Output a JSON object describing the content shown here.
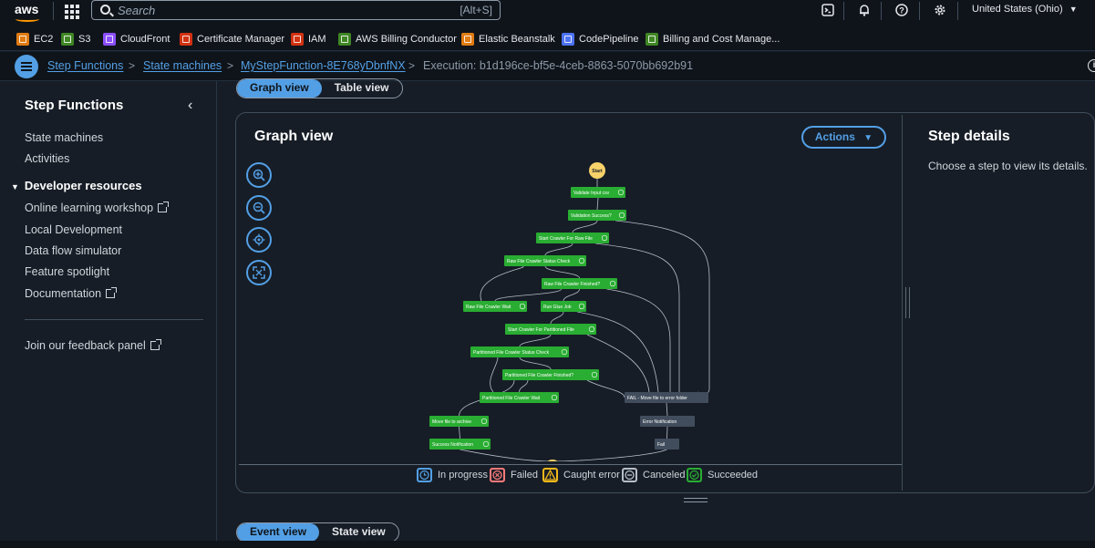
{
  "topbar": {
    "logo_text": "aws",
    "search_placeholder": "Search",
    "search_shortcut": "[Alt+S]",
    "region": "United States (Ohio)",
    "icons": [
      "cloudshell-icon",
      "bell-icon",
      "help-icon",
      "gear-icon"
    ]
  },
  "favorites": [
    {
      "label": "EC2",
      "color": "#e07b12"
    },
    {
      "label": "S3",
      "color": "#3f8624"
    },
    {
      "label": "CloudFront",
      "color": "#8c4fff"
    },
    {
      "label": "Certificate Manager",
      "color": "#d13212"
    },
    {
      "label": "IAM",
      "color": "#d13212"
    },
    {
      "label": "AWS Billing Conductor",
      "color": "#3f8624"
    },
    {
      "label": "Elastic Beanstalk",
      "color": "#e07b12"
    },
    {
      "label": "CodePipeline",
      "color": "#4d72f3"
    },
    {
      "label": "Billing and Cost Manage...",
      "color": "#3f8624"
    }
  ],
  "breadcrumb": {
    "items": [
      "Step Functions",
      "State machines",
      "MyStepFunction-8E768yDbnfNX"
    ],
    "current": "Execution: b1d196ce-bf5e-4ceb-8863-5070bb692b91"
  },
  "sidebar": {
    "title": "Step Functions",
    "items": [
      "State machines",
      "Activities"
    ],
    "section_title": "Developer resources",
    "section_items": [
      "Online learning workshop",
      "Local Development",
      "Data flow simulator",
      "Feature spotlight",
      "Documentation"
    ],
    "feedback": "Join our feedback panel"
  },
  "view_tabs": {
    "graph": "Graph view",
    "table": "Table view"
  },
  "graph_panel": {
    "title": "Graph view",
    "actions_label": "Actions",
    "zoom_controls": [
      "zoom-in-icon",
      "zoom-out-icon",
      "center-icon",
      "fit-icon"
    ]
  },
  "graph": {
    "start_label": "Start",
    "nodes": [
      {
        "label": "Validate Input csv",
        "status": "succeeded"
      },
      {
        "label": "Validation Success?",
        "status": "succeeded"
      },
      {
        "label": "Start Crawler For Raw File",
        "status": "succeeded"
      },
      {
        "label": "Raw File Crawler Status Check",
        "status": "succeeded"
      },
      {
        "label": "Raw File Crawler Finished?",
        "status": "succeeded"
      },
      {
        "label": "Raw File Crawler Wait",
        "status": "succeeded"
      },
      {
        "label": "Run Glue Job",
        "status": "succeeded"
      },
      {
        "label": "Start Crawler For Partitioned File",
        "status": "succeeded"
      },
      {
        "label": "Partitioned File Crawler Status Check",
        "status": "succeeded"
      },
      {
        "label": "Partitioned File Crawler Finished?",
        "status": "succeeded"
      },
      {
        "label": "Partitioned File Crawler Wait",
        "status": "succeeded"
      },
      {
        "label": "FAIL - Move file to error folder",
        "status": "not-run"
      },
      {
        "label": "Move file to archive",
        "status": "succeeded"
      },
      {
        "label": "Error Notification",
        "status": "not-run"
      },
      {
        "label": "Success Notification",
        "status": "succeeded"
      },
      {
        "label": "Fail",
        "status": "not-run"
      }
    ]
  },
  "details": {
    "title": "Step details",
    "text": "Choose a step to view its details."
  },
  "legend": [
    {
      "label": "In progress",
      "color": "#539fe5"
    },
    {
      "label": "Failed",
      "color": "#ff7a7a"
    },
    {
      "label": "Caught error",
      "color": "#f2b81b"
    },
    {
      "label": "Canceled",
      "color": "#b6bec9"
    },
    {
      "label": "Succeeded",
      "color": "#29ad32"
    }
  ],
  "bottom_tabs": {
    "event": "Event view",
    "state": "State view"
  },
  "colors": {
    "accent": "#539fe5",
    "succeeded_node": "#29ad32",
    "not_run_node": "#414d5c",
    "start_node": "#f7d26a"
  }
}
